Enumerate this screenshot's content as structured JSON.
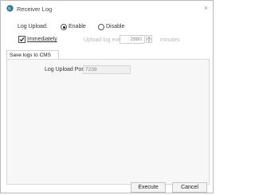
{
  "window": {
    "title": "Receiver Log",
    "close_glyph": "×"
  },
  "log_upload": {
    "label": "Log Upload:",
    "enable_label": "Enable",
    "disable_label": "Disable",
    "selected": "Enable"
  },
  "immediately": {
    "label": "Immediately",
    "checked": true
  },
  "upload_interval": {
    "prefix": "Upload log every",
    "value": "2880",
    "suffix": "minutes",
    "disabled": true
  },
  "tabs": [
    {
      "label": "Save logs to CMS",
      "active": true
    }
  ],
  "panel": {
    "port_label": "Log Upload Port:",
    "port_value": "7238"
  },
  "buttons": {
    "execute": "Execute",
    "cancel": "Cancel"
  }
}
